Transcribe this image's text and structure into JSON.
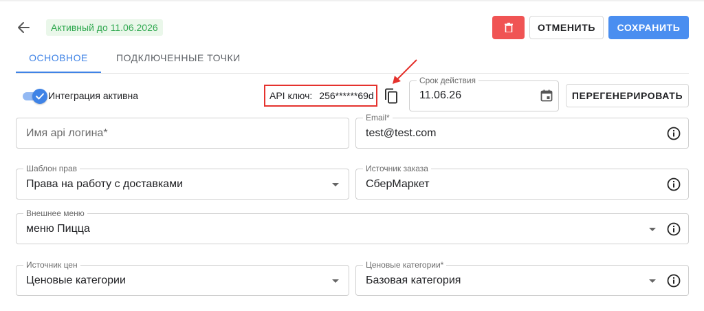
{
  "header": {
    "status_badge": "Активный до 11.06.2026",
    "delete_button": {
      "icon": "trash-icon",
      "color": "#f05454"
    },
    "cancel_label": "ОТМЕНИТЬ",
    "save_label": "СОХРАНИТЬ",
    "accent_color": "#4a8ef0"
  },
  "tabs": [
    {
      "label": "ОСНОВНОЕ",
      "active": true
    },
    {
      "label": "ПОДКЛЮЧЕННЫЕ ТОЧКИ",
      "active": false
    }
  ],
  "integration": {
    "toggle_label": "Интеграция активна",
    "enabled": true,
    "api_key_label": "API ключ:",
    "api_key_value": "256******69d",
    "copy_icon": "copy-icon"
  },
  "expiry": {
    "label": "Срок действия",
    "value": "11.06.26",
    "icon": "calendar-icon"
  },
  "regenerate_label": "ПЕРЕГЕНЕРИРОВАТЬ",
  "form": {
    "api_login": {
      "placeholder": "Имя api логина*",
      "value": ""
    },
    "email": {
      "label": "Email*",
      "value": "test@test.com"
    },
    "rights_template": {
      "label": "Шаблон прав",
      "value": "Права на работу с доставками"
    },
    "order_source": {
      "label": "Источник заказа",
      "value": "СберМаркет"
    },
    "external_menu": {
      "label": "Внешнее меню",
      "value": "меню Пицца"
    },
    "price_source": {
      "label": "Источник цен",
      "value": "Ценовые категории"
    },
    "price_categories": {
      "label": "Ценовые категории*",
      "value": "Базовая категория"
    }
  }
}
